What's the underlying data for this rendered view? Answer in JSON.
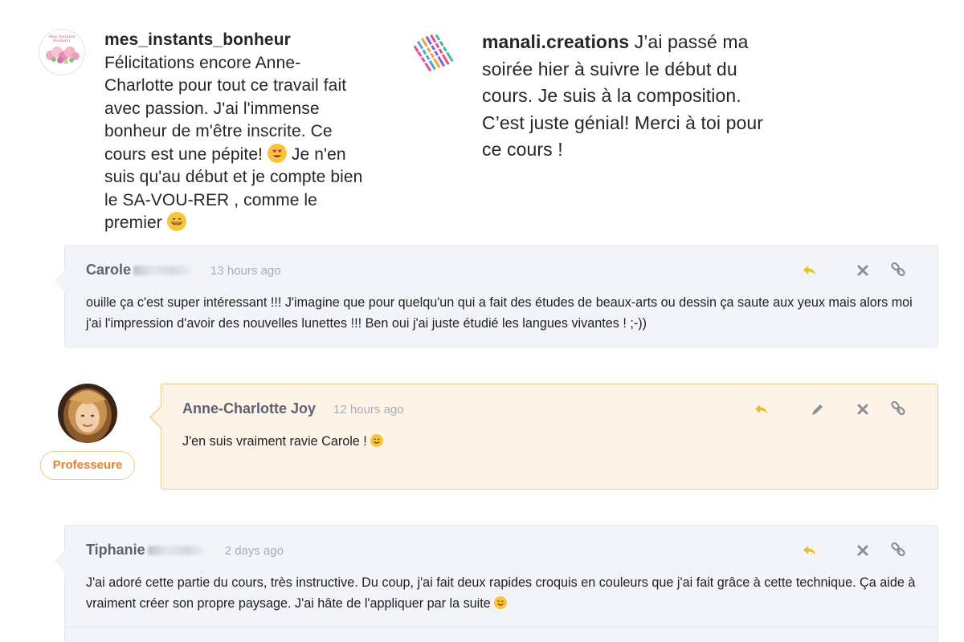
{
  "instagram": [
    {
      "username": "mes_instants_bonheur",
      "avatar_text": "Mes Instants Bonheur",
      "lines": [
        "Félicitations encore Anne-",
        "Charlotte pour tout ce travail fait",
        "avec passion. J'ai l'immense",
        "bonheur de m'être inscrite. Ce"
      ],
      "line5a": "cours est une pépite! ",
      "line5b": " Je n'en",
      "line6": "suis qu'au début et je compte bien",
      "line7": "le SA-VOU-RER , comme le",
      "line8": "premier "
    },
    {
      "username": "manali.creations",
      "text_first": " J’ai passé ma",
      "lines": [
        "soirée hier à suivre le début du",
        "cours. Je suis à la composition.",
        "C’est juste génial! Merci à toi pour",
        "ce cours !"
      ]
    }
  ],
  "comments": [
    {
      "author": "Carole",
      "time": "13 hours ago",
      "text": "ouille ça c'est super intéressant !!! J'imagine que pour quelqu'un qui a fait des études de beaux-arts ou dessin ça saute aux yeux mais alors moi j'ai l'impression d'avoir des nouvelles lunettes !!! Ben oui j'ai juste étudié les langues vivantes ! ;-))"
    },
    {
      "author": "Anne-Charlotte Joy",
      "time": "12 hours ago",
      "text": "J'en suis vraiment ravie Carole ! ",
      "badge": "Professeure"
    },
    {
      "author": "Tiphanie",
      "time": "2 days ago",
      "text": "J'ai adoré cette partie du cours, très instructive. Du coup, j'ai fait deux rapides croquis en couleurs que j'ai fait grâce à cette technique. Ça aide à vraiment créer son propre paysage. J'ai hâte de l'appliquer par la suite "
    }
  ],
  "colors": {
    "reply_icon": "#e8c21d",
    "icon_gray": "#8b8f9a",
    "badge_text": "#ec7d2e",
    "orange_border": "#f3c98f"
  },
  "icons": [
    "reply-icon",
    "close-icon",
    "link-icon",
    "edit-icon",
    "heart-eyes-emoji",
    "grin-emoji",
    "smile-emoji"
  ]
}
